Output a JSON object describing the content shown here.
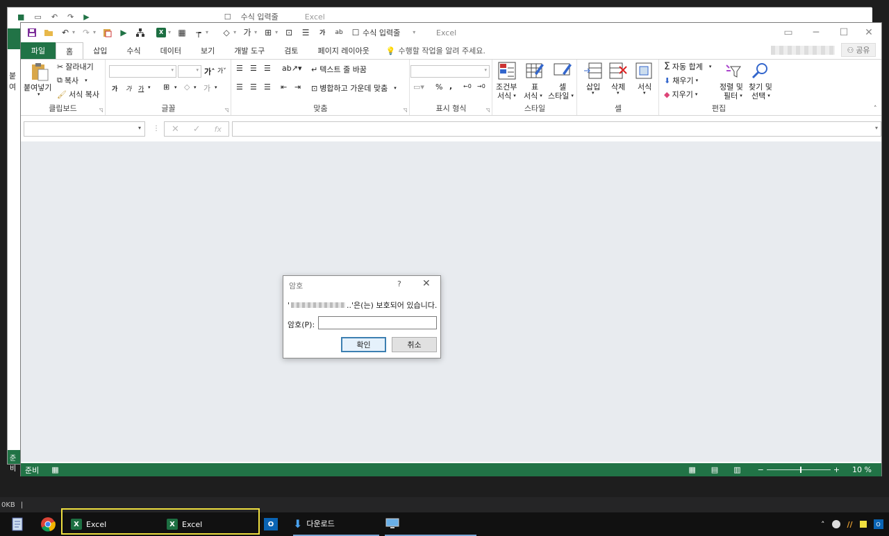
{
  "window": {
    "title": "Excel"
  },
  "background_window": {
    "title": "Excel",
    "formula_input_label": "수식 입력줄",
    "status": "준비"
  },
  "tabs": [
    {
      "label": "파일"
    },
    {
      "label": "홈"
    },
    {
      "label": "삽입"
    },
    {
      "label": "수식"
    },
    {
      "label": "데이터"
    },
    {
      "label": "보기"
    },
    {
      "label": "개발 도구"
    },
    {
      "label": "검토"
    },
    {
      "label": "페이지 레이아웃"
    }
  ],
  "qat": {
    "formula_input_label": "수식 입력줄"
  },
  "tellme": "수행할 작업을 알려 주세요.",
  "share": "공유",
  "ribbon": {
    "clipboard": {
      "paste": "붙여넣기",
      "cut": "잘라내기",
      "copy": "복사",
      "format_painter": "서식 복사",
      "label": "클립보드"
    },
    "font": {
      "label": "글꼴",
      "bold": "가",
      "italic": "가",
      "underline": "가",
      "font_color": "가"
    },
    "align": {
      "wrap": "텍스트 줄 바꿈",
      "merge": "병합하고 가운데 맞춤",
      "label": "맞춤"
    },
    "number": {
      "percent": "%",
      "comma": ",",
      "label": "표시 형식"
    },
    "styles": {
      "conditional": "조건부",
      "conditional2": "서식",
      "table": "표",
      "table2": "서식",
      "cell": "셀",
      "cell2": "스타일",
      "label": "스타일"
    },
    "cells": {
      "insert": "삽입",
      "delete": "삭제",
      "format": "서식",
      "label": "셀"
    },
    "editing": {
      "autosum": "자동 합계",
      "fill": "채우기",
      "clear": "지우기",
      "sort": "정렬 및",
      "sort2": "필터",
      "find": "찾기 및",
      "find2": "선택",
      "label": "편집"
    }
  },
  "formula_bar": {
    "fx": "fx"
  },
  "status": {
    "ready": "준비",
    "zoom": "10 %"
  },
  "dialog": {
    "title": "암호",
    "help": "?",
    "message": "..'은(는) 보호되어 있습니다.",
    "label": "암호(P):",
    "ok": "확인",
    "cancel": "취소"
  },
  "below_bar": {
    "text": "0KB"
  },
  "taskbar": {
    "items": [
      {
        "label": "Excel"
      },
      {
        "label": "Excel"
      },
      {
        "label": "다운로드"
      }
    ]
  },
  "colors": {
    "excel_green": "#217346",
    "highlight": "#f0e040"
  }
}
